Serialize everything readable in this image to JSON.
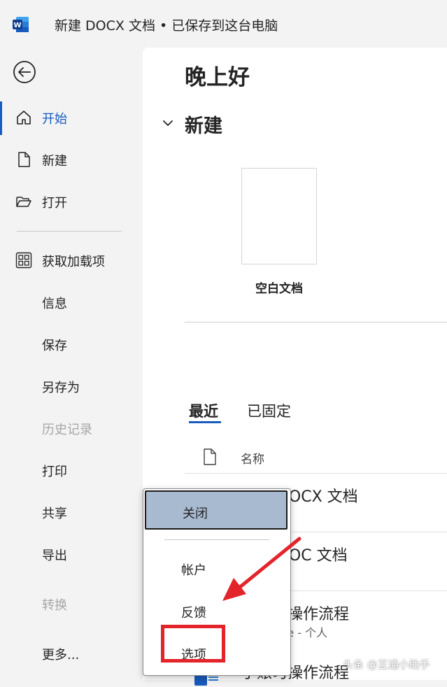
{
  "titlebar": {
    "title": "新建 DOCX 文档 • 已保存到这台电脑"
  },
  "nav": {
    "back_icon": "back-arrow-icon",
    "items": [
      {
        "label": "开始",
        "icon": "home-icon",
        "active": true
      },
      {
        "label": "新建",
        "icon": "new-document-icon"
      },
      {
        "label": "打开",
        "icon": "folder-open-icon"
      },
      {
        "label": "获取加载项",
        "icon": "add-ins-grid-icon"
      },
      {
        "label": "信息"
      },
      {
        "label": "保存"
      },
      {
        "label": "另存为"
      },
      {
        "label": "历史记录",
        "disabled": true
      },
      {
        "label": "打印"
      },
      {
        "label": "共享"
      },
      {
        "label": "导出"
      },
      {
        "label": "转换",
        "disabled": true
      },
      {
        "label": "更多..."
      }
    ]
  },
  "main": {
    "greeting": "晚上好",
    "new_section": "新建",
    "blank_doc_label": "空白文档",
    "tabs": [
      {
        "label": "最近",
        "active": true
      },
      {
        "label": "已固定"
      }
    ],
    "column_name": "名称",
    "files": [
      {
        "name": "新建 DOCX 文档"
      },
      {
        "name": "新建 DOC 文档"
      },
      {
        "name": "手账习操作流程",
        "sub": "OneDrive - 个人"
      },
      {
        "name": "手账习操作流程"
      }
    ]
  },
  "popup": {
    "close_label": "关闭",
    "items": [
      "帐户",
      "反馈",
      "选项"
    ]
  },
  "watermark": "头条 @互通小助手",
  "colors": {
    "accent": "#185abd",
    "highlight": "#a8bacf",
    "annotation_red": "#e3242b"
  }
}
